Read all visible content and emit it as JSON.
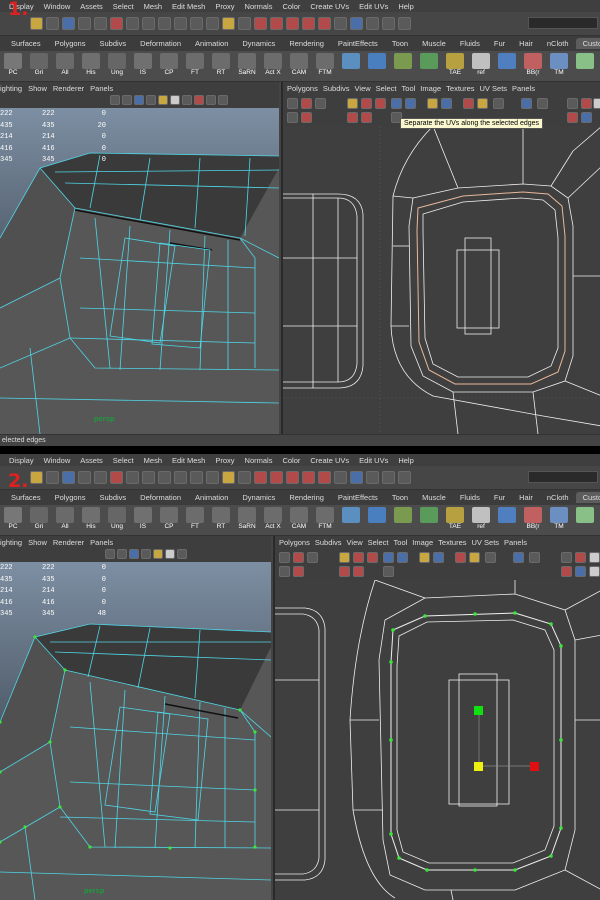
{
  "menu": [
    "Display",
    "Window",
    "Assets",
    "Select",
    "Mesh",
    "Edit Mesh",
    "Proxy",
    "Normals",
    "Color",
    "Create UVs",
    "Edit UVs",
    "Help"
  ],
  "shelf_tabs": [
    "Surfaces",
    "Polygons",
    "Subdivs",
    "Deformation",
    "Animation",
    "Dynamics",
    "Rendering",
    "PaintEffects",
    "Toon",
    "Muscle",
    "Fluids",
    "Fur",
    "Hair",
    "nCloth",
    "Custom"
  ],
  "shelf_buttons": [
    "PC",
    "Gri",
    "All",
    "His",
    "Ung",
    "IS",
    "CP",
    "FT",
    "RT",
    "SaRN",
    "Act X",
    "CAM",
    "FTM",
    "",
    "",
    "",
    "",
    "TAE",
    "ref",
    "",
    "BB(r",
    "TM",
    ""
  ],
  "viewport_menu": [
    "ighting",
    "Show",
    "Renderer",
    "Panels"
  ],
  "uv_menu": [
    "Polygons",
    "Subdivs",
    "View",
    "Select",
    "Tool",
    "Image",
    "Textures",
    "UV Sets",
    "Panels"
  ],
  "panel1": {
    "step": "1.",
    "stats": [
      [
        "222",
        "222",
        "0"
      ],
      [
        "435",
        "435",
        "20"
      ],
      [
        "214",
        "214",
        "0"
      ],
      [
        "416",
        "416",
        "0"
      ],
      [
        "345",
        "345",
        "0"
      ]
    ],
    "camera": "persp",
    "tooltip": "Separate the UVs along the selected edges",
    "help_line": "elected edges"
  },
  "panel2": {
    "step": "2.",
    "stats": [
      [
        "222",
        "222",
        "0"
      ],
      [
        "435",
        "435",
        "0"
      ],
      [
        "214",
        "214",
        "0"
      ],
      [
        "416",
        "416",
        "0"
      ],
      [
        "345",
        "345",
        "48"
      ]
    ],
    "camera": "persp"
  },
  "colors": {
    "wire": "#4fd6e6",
    "uv_wire": "#f0f0f0",
    "uv_selected": "#e8b89a",
    "vertex_green": "#39e639",
    "manip_red": "#e01010",
    "manip_green": "#10e010",
    "manip_yellow": "#f0f010"
  }
}
